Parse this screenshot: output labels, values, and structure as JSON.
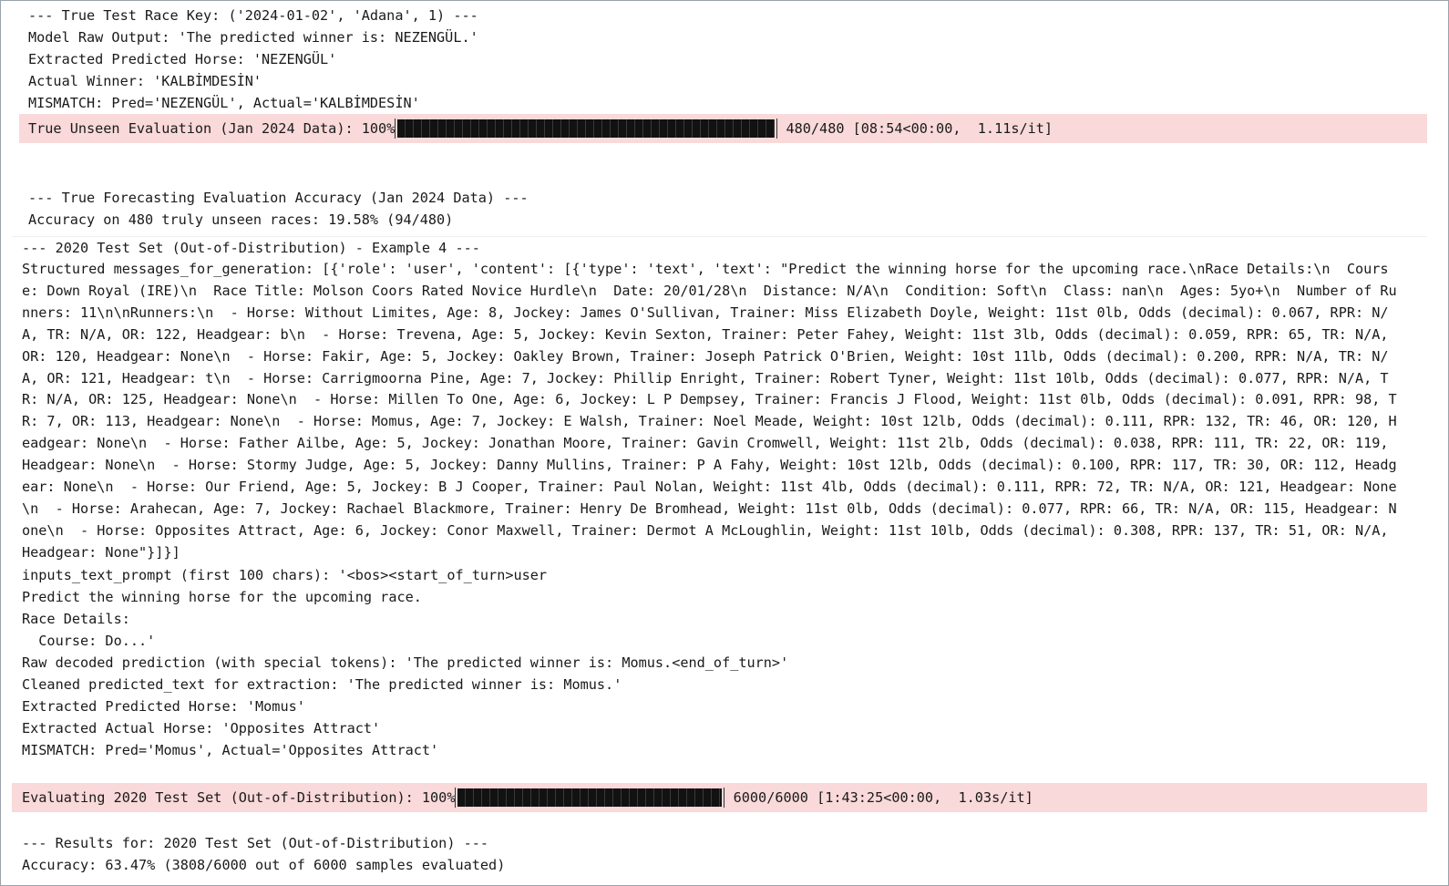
{
  "cell1": [
    "--- True Test Race Key: ('2024-01-02', 'Adana', 1) ---",
    "Model Raw Output: 'The predicted winner is: NEZENGÜL.'",
    "Extracted Predicted Horse: 'NEZENGÜL'",
    "Actual Winner: 'KALBİMDESİN'",
    "MISMATCH: Pred='NEZENGÜL', Actual='KALBİMDESİN'"
  ],
  "progress1": {
    "label": "True Unseen Evaluation (Jan 2024 Data): 100%",
    "fraction": 1.0,
    "stats": " 480/480 [08:54<00:00,  1.11s/it]"
  },
  "cell3": [
    "--- True Forecasting Evaluation Accuracy (Jan 2024 Data) ---",
    "Accuracy on 480 truly unseen races: 19.58% (94/480)"
  ],
  "cell4": {
    "header": "--- 2020 Test Set (Out-of-Distribution) - Example 4 ---",
    "structured": "Structured messages_for_generation: [{'role': 'user', 'content': [{'type': 'text', 'text': \"Predict the winning horse for the upcoming race.\\nRace Details:\\n  Course: Down Royal (IRE)\\n  Race Title: Molson Coors Rated Novice Hurdle\\n  Date: 20/01/28\\n  Distance: N/A\\n  Condition: Soft\\n  Class: nan\\n  Ages: 5yo+\\n  Number of Runners: 11\\n\\nRunners:\\n  - Horse: Without Limites, Age: 8, Jockey: James O'Sullivan, Trainer: Miss Elizabeth Doyle, Weight: 11st 0lb, Odds (decimal): 0.067, RPR: N/A, TR: N/A, OR: 122, Headgear: b\\n  - Horse: Trevena, Age: 5, Jockey: Kevin Sexton, Trainer: Peter Fahey, Weight: 11st 3lb, Odds (decimal): 0.059, RPR: 65, TR: N/A, OR: 120, Headgear: None\\n  - Horse: Fakir, Age: 5, Jockey: Oakley Brown, Trainer: Joseph Patrick O'Brien, Weight: 10st 11lb, Odds (decimal): 0.200, RPR: N/A, TR: N/A, OR: 121, Headgear: t\\n  - Horse: Carrigmoorna Pine, Age: 7, Jockey: Phillip Enright, Trainer: Robert Tyner, Weight: 11st 10lb, Odds (decimal): 0.077, RPR: N/A, TR: N/A, OR: 125, Headgear: None\\n  - Horse: Millen To One, Age: 6, Jockey: L P Dempsey, Trainer: Francis J Flood, Weight: 11st 0lb, Odds (decimal): 0.091, RPR: 98, TR: 7, OR: 113, Headgear: None\\n  - Horse: Momus, Age: 7, Jockey: E Walsh, Trainer: Noel Meade, Weight: 10st 12lb, Odds (decimal): 0.111, RPR: 132, TR: 46, OR: 120, Headgear: None\\n  - Horse: Father Ailbe, Age: 5, Jockey: Jonathan Moore, Trainer: Gavin Cromwell, Weight: 11st 2lb, Odds (decimal): 0.038, RPR: 111, TR: 22, OR: 119, Headgear: None\\n  - Horse: Stormy Judge, Age: 5, Jockey: Danny Mullins, Trainer: P A Fahy, Weight: 10st 12lb, Odds (decimal): 0.100, RPR: 117, TR: 30, OR: 112, Headgear: None\\n  - Horse: Our Friend, Age: 5, Jockey: B J Cooper, Trainer: Paul Nolan, Weight: 11st 4lb, Odds (decimal): 0.111, RPR: 72, TR: N/A, OR: 121, Headgear: None\\n  - Horse: Arahecan, Age: 7, Jockey: Rachael Blackmore, Trainer: Henry De Bromhead, Weight: 11st 0lb, Odds (decimal): 0.077, RPR: 66, TR: N/A, OR: 115, Headgear: None\\n  - Horse: Opposites Attract, Age: 6, Jockey: Conor Maxwell, Trainer: Dermot A McLoughlin, Weight: 11st 10lb, Odds (decimal): 0.308, RPR: 137, TR: 51, OR: N/A, Headgear: None\"}]}]",
    "lines": [
      "inputs_text_prompt (first 100 chars): '<bos><start_of_turn>user",
      "Predict the winning horse for the upcoming race.",
      "Race Details:",
      "  Course: Do...'",
      "Raw decoded prediction (with special tokens): 'The predicted winner is: Momus.<end_of_turn>'",
      "Cleaned predicted_text for extraction: 'The predicted winner is: Momus.'",
      "Extracted Predicted Horse: 'Momus'",
      "Extracted Actual Horse: 'Opposites Attract'",
      "MISMATCH: Pred='Momus', Actual='Opposites Attract'"
    ]
  },
  "progress2": {
    "label": "Evaluating 2020 Test Set (Out-of-Distribution): 100%",
    "fraction": 1.0,
    "stats": " 6000/6000 [1:43:25<00:00,  1.03s/it]"
  },
  "cell6": [
    "--- Results for: 2020 Test Set (Out-of-Distribution) ---",
    "Accuracy: 63.47% (3808/6000 out of 6000 samples evaluated)"
  ]
}
